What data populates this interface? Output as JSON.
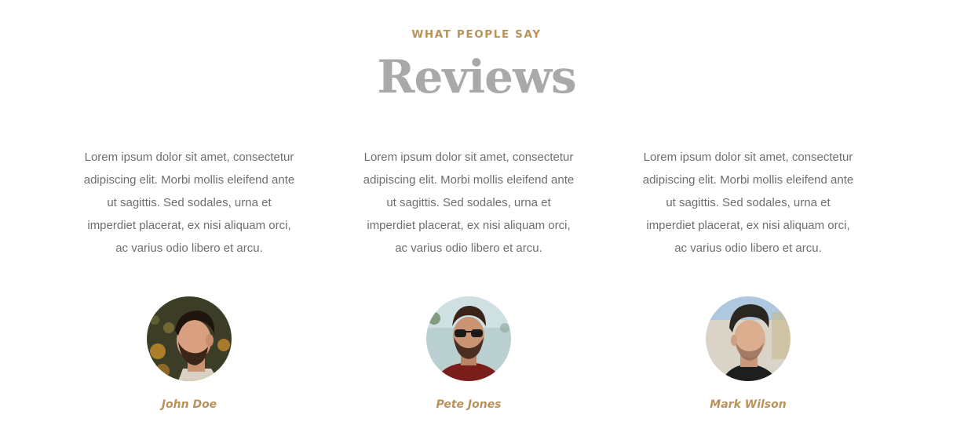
{
  "section": {
    "eyebrow": "WHAT PEOPLE SAY",
    "title": "Reviews"
  },
  "reviews": [
    {
      "text": "Lorem ipsum dolor sit amet, consectetur adipiscing elit. Morbi mollis eleifend ante ut sagittis. Sed sodales, urna et imperdiet placerat, ex nisi aliquam orci, ac varius odio libero et arcu.",
      "name": "John Doe",
      "avatar_icon": "person-photo-icon"
    },
    {
      "text": "Lorem ipsum dolor sit amet, consectetur adipiscing elit. Morbi mollis eleifend ante ut sagittis. Sed sodales, urna et imperdiet placerat, ex nisi aliquam orci, ac varius odio libero et arcu.",
      "name": "Pete Jones",
      "avatar_icon": "person-photo-icon"
    },
    {
      "text": "Lorem ipsum dolor sit amet, consectetur adipiscing elit. Morbi mollis eleifend ante ut sagittis. Sed sodales, urna et imperdiet placerat, ex nisi aliquam orci, ac varius odio libero et arcu.",
      "name": "Mark Wilson",
      "avatar_icon": "person-photo-icon"
    }
  ],
  "colors": {
    "accent": "#b9925a",
    "title": "#a9a9a9",
    "body_text": "#6e6e6e",
    "background": "#ffffff"
  }
}
